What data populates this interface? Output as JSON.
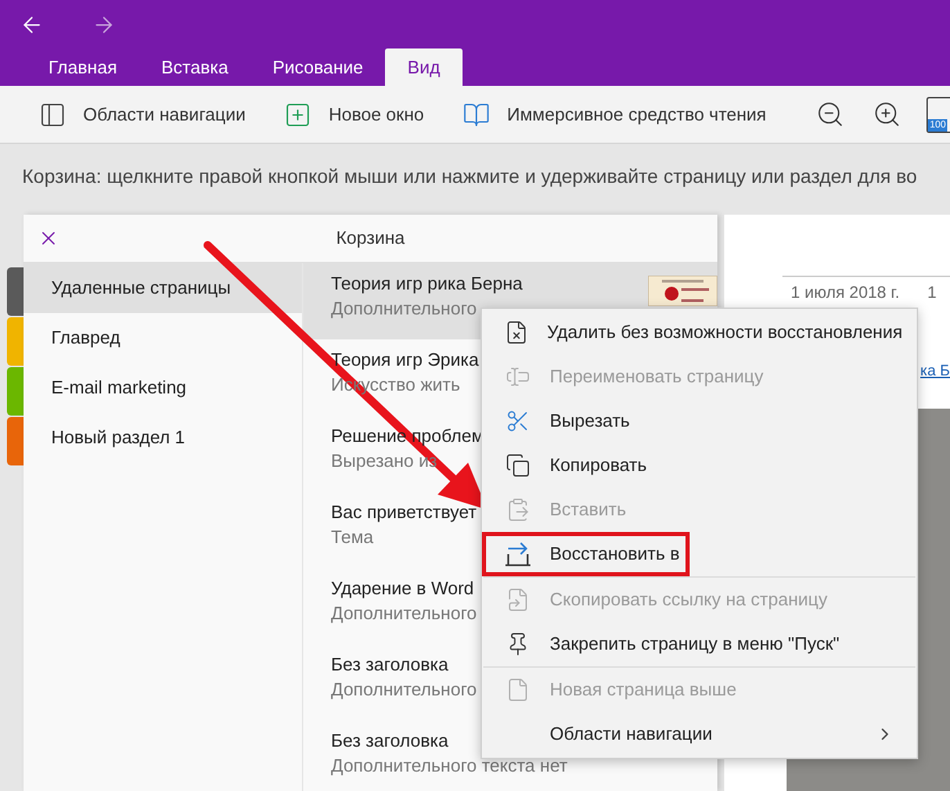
{
  "nav_buttons": [
    {
      "kind": "back",
      "disabled": false
    },
    {
      "kind": "forward",
      "disabled": true
    }
  ],
  "tabs": [
    {
      "label": "Главная",
      "selected": false
    },
    {
      "label": "Вставка",
      "selected": false
    },
    {
      "label": "Рисование",
      "selected": false
    },
    {
      "label": "Вид",
      "selected": true
    }
  ],
  "toolbar": [
    {
      "kind": "nav-panes",
      "label": "Области навигации"
    },
    {
      "kind": "new-window",
      "label": "Новое окно"
    },
    {
      "kind": "reader",
      "label": "Иммерсивное средство чтения"
    },
    {
      "kind": "divider"
    },
    {
      "kind": "zoom-out"
    },
    {
      "kind": "zoom-in"
    },
    {
      "kind": "page-zoom",
      "label": "100"
    }
  ],
  "info_bar": {
    "text": "Корзина: щелкните правой кнопкой мыши или нажмите и удерживайте страницу или раздел для во"
  },
  "trash_panel": {
    "title": "Корзина",
    "sections": [
      {
        "label": "Удаленные страницы",
        "color": "#5a5a5a",
        "selected": true
      },
      {
        "label": "Главред",
        "color": "#f0b400",
        "selected": false
      },
      {
        "label": "E-mail marketing",
        "color": "#6bb700",
        "selected": false
      },
      {
        "label": "Новый раздел 1",
        "color": "#e8650a",
        "selected": false
      }
    ],
    "pages": [
      {
        "title": "Теория игр рика Берна",
        "subtitle": "Дополнительного",
        "selected": true,
        "thumbnail": true
      },
      {
        "title": "Теория игр Эрика",
        "subtitle": "Искусство жить",
        "selected": false,
        "thumbnail": false
      },
      {
        "title": "Решение проблем",
        "subtitle": "Вырезано из",
        "selected": false,
        "thumbnail": false
      },
      {
        "title": "Вас приветствует",
        "subtitle": "Тема",
        "selected": false,
        "thumbnail": false
      },
      {
        "title": "Ударение в Word",
        "subtitle": "Дополнительного",
        "selected": false,
        "thumbnail": false
      },
      {
        "title": "Без заголовка",
        "subtitle": "Дополнительного",
        "selected": false,
        "thumbnail": false
      },
      {
        "title": "Без заголовка",
        "subtitle": "Дополнительного текста нет",
        "selected": false,
        "thumbnail": false
      }
    ]
  },
  "page_view": {
    "date": "1 июля 2018 г.",
    "time": "1",
    "link": "ка Б"
  },
  "context_menu": [
    {
      "kind": "delete",
      "label": "Удалить без возможности восстановления",
      "disabled": false,
      "annotated": false
    },
    {
      "kind": "rename",
      "label": "Переименовать страницу",
      "disabled": true,
      "annotated": false
    },
    {
      "kind": "cut",
      "label": "Вырезать",
      "disabled": false,
      "annotated": false
    },
    {
      "kind": "copy",
      "label": "Копировать",
      "disabled": false,
      "annotated": false
    },
    {
      "kind": "paste",
      "label": "Вставить",
      "disabled": true,
      "annotated": false
    },
    {
      "kind": "restore",
      "label": "Восстановить в",
      "disabled": false,
      "annotated": true
    },
    {
      "kind": "divider"
    },
    {
      "kind": "link",
      "label": "Скопировать ссылку на страницу",
      "disabled": true,
      "annotated": false
    },
    {
      "kind": "pin",
      "label": "Закрепить страницу в меню \"Пуск\"",
      "disabled": false,
      "annotated": false
    },
    {
      "kind": "divider"
    },
    {
      "kind": "page",
      "label": "Новая страница выше",
      "disabled": true,
      "annotated": false
    },
    {
      "kind": "submenu",
      "label": "Области навигации",
      "disabled": false,
      "annotated": false
    }
  ]
}
